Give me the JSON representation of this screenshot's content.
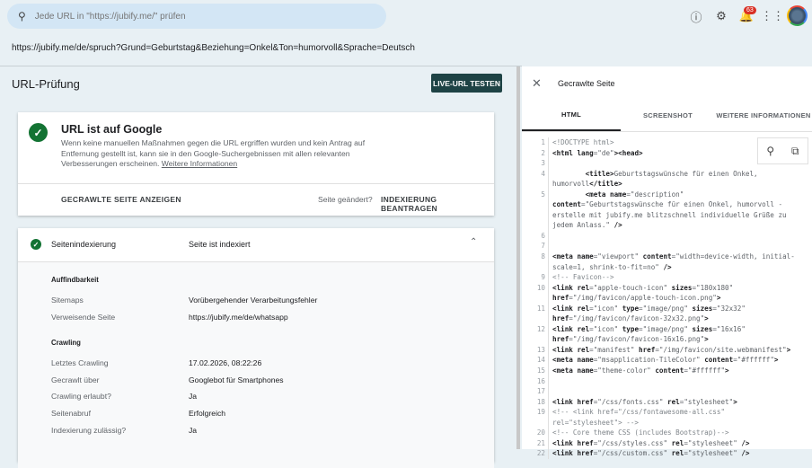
{
  "topbar": {
    "search_placeholder": "Jede URL in \"https://jubify.me/\" prüfen",
    "notification_count": "63"
  },
  "inspected_url": "https://jubify.me/de/spruch?Grund=Geburtstag&Beziehung=Onkel&Ton=humorvoll&Sprache=Deutsch",
  "page_title": "URL-Prüfung",
  "live_test_label": "LIVE-URL TESTEN",
  "status_card": {
    "title": "URL ist auf Google",
    "text": "Wenn keine manuellen Maßnahmen gegen die URL ergriffen wurden und kein Antrag auf Entfernung gestellt ist, kann sie in den Google-Suchergebnissen mit allen relevanten Verbesserungen erscheinen. ",
    "link": "Weitere Informationen",
    "view_crawled": "GECRAWLTE SEITE ANZEIGEN",
    "changed": "Seite geändert?",
    "request_indexing": "INDEXIERUNG BEANTRAGEN"
  },
  "indexing": {
    "label": "Seitenindexierung",
    "value": "Seite ist indexiert",
    "sections": [
      {
        "title": "Auffindbarkeit",
        "rows": [
          {
            "label": "Sitemaps",
            "value": "Vorübergehender Verarbeitungsfehler"
          },
          {
            "label": "Verweisende Seite",
            "value": "https://jubify.me/de/whatsapp"
          }
        ]
      },
      {
        "title": "Crawling",
        "rows": [
          {
            "label": "Letztes Crawling",
            "value": "17.02.2026, 08:22:26"
          },
          {
            "label": "Gecrawlt über",
            "value": "Googlebot für Smartphones"
          },
          {
            "label": "Crawling erlaubt?",
            "value": "Ja"
          },
          {
            "label": "Seitenabruf",
            "value": "Erfolgreich"
          },
          {
            "label": "Indexierung zulässig?",
            "value": "Ja"
          }
        ]
      }
    ]
  },
  "panel": {
    "title": "Gecrawlte Seite",
    "tabs": [
      "HTML",
      "SCREENSHOT",
      "WEITERE INFORMATIONEN"
    ],
    "code": [
      [
        [
          "com",
          "<!DOCTYPE html>"
        ]
      ],
      [
        [
          "tag",
          "<html "
        ],
        [
          "attr",
          "lang"
        ],
        [
          "txt",
          "=\"de\""
        ],
        [
          "tag",
          ">"
        ],
        [
          "tag",
          "<head>"
        ]
      ],
      [],
      [
        [
          "txt",
          "        "
        ],
        [
          "tag",
          "<title>"
        ],
        [
          "txt",
          "Geburtstagswünsche für einen Onkel, humorvoll"
        ],
        [
          "tag",
          "</title>"
        ]
      ],
      [
        [
          "txt",
          "        "
        ],
        [
          "tag",
          "<meta "
        ],
        [
          "attr",
          "name"
        ],
        [
          "txt",
          "=\"description\" "
        ],
        [
          "attr",
          "content"
        ],
        [
          "txt",
          "=\"Geburtstagswünsche für einen Onkel, humorvoll - erstelle mit jubify.me blitzschnell individuelle Grüße zu jedem Anlass.\" "
        ],
        [
          "tag",
          "/>"
        ]
      ],
      [],
      [],
      [
        [
          "tag",
          "<meta "
        ],
        [
          "attr",
          "name"
        ],
        [
          "txt",
          "=\"viewport\" "
        ],
        [
          "attr",
          "content"
        ],
        [
          "txt",
          "=\"width=device-width, initial-scale=1, shrink-to-fit=no\" "
        ],
        [
          "tag",
          "/>"
        ]
      ],
      [
        [
          "com",
          "<!-- Favicon-->"
        ]
      ],
      [
        [
          "tag",
          "<link "
        ],
        [
          "attr",
          "rel"
        ],
        [
          "txt",
          "=\"apple-touch-icon\" "
        ],
        [
          "attr",
          "sizes"
        ],
        [
          "txt",
          "=\"180x180\" "
        ],
        [
          "attr",
          "href"
        ],
        [
          "txt",
          "=\"/img/favicon/apple-touch-icon.png\""
        ],
        [
          "tag",
          ">"
        ]
      ],
      [
        [
          "tag",
          "<link "
        ],
        [
          "attr",
          "rel"
        ],
        [
          "txt",
          "=\"icon\" "
        ],
        [
          "attr",
          "type"
        ],
        [
          "txt",
          "=\"image/png\" "
        ],
        [
          "attr",
          "sizes"
        ],
        [
          "txt",
          "=\"32x32\" "
        ],
        [
          "attr",
          "href"
        ],
        [
          "txt",
          "=\"/img/favicon/favicon-32x32.png\""
        ],
        [
          "tag",
          ">"
        ]
      ],
      [
        [
          "tag",
          "<link "
        ],
        [
          "attr",
          "rel"
        ],
        [
          "txt",
          "=\"icon\" "
        ],
        [
          "attr",
          "type"
        ],
        [
          "txt",
          "=\"image/png\" "
        ],
        [
          "attr",
          "sizes"
        ],
        [
          "txt",
          "=\"16x16\" "
        ],
        [
          "attr",
          "href"
        ],
        [
          "txt",
          "=\"/img/favicon/favicon-16x16.png\""
        ],
        [
          "tag",
          ">"
        ]
      ],
      [
        [
          "tag",
          "<link "
        ],
        [
          "attr",
          "rel"
        ],
        [
          "txt",
          "=\"manifest\" "
        ],
        [
          "attr",
          "href"
        ],
        [
          "txt",
          "=\"/img/favicon/site.webmanifest\""
        ],
        [
          "tag",
          ">"
        ]
      ],
      [
        [
          "tag",
          "<meta "
        ],
        [
          "attr",
          "name"
        ],
        [
          "txt",
          "=\"msapplication-TileColor\" "
        ],
        [
          "attr",
          "content"
        ],
        [
          "txt",
          "=\"#ffffff\""
        ],
        [
          "tag",
          ">"
        ]
      ],
      [
        [
          "tag",
          "<meta "
        ],
        [
          "attr",
          "name"
        ],
        [
          "txt",
          "=\"theme-color\" "
        ],
        [
          "attr",
          "content"
        ],
        [
          "txt",
          "=\"#ffffff\""
        ],
        [
          "tag",
          ">"
        ]
      ],
      [],
      [],
      [
        [
          "tag",
          "<link "
        ],
        [
          "attr",
          "href"
        ],
        [
          "txt",
          "=\"/css/fonts.css\" "
        ],
        [
          "attr",
          "rel"
        ],
        [
          "txt",
          "=\"stylesheet\""
        ],
        [
          "tag",
          ">"
        ]
      ],
      [
        [
          "com",
          "<!-- <link href=\"/css/fontawesome-all.css\" rel=\"stylesheet\"> -->"
        ]
      ],
      [
        [
          "com",
          "<!-- Core theme CSS (includes Bootstrap)-->"
        ]
      ],
      [
        [
          "tag",
          "<link "
        ],
        [
          "attr",
          "href"
        ],
        [
          "txt",
          "=\"/css/styles.css\" "
        ],
        [
          "attr",
          "rel"
        ],
        [
          "txt",
          "=\"stylesheet\" "
        ],
        [
          "tag",
          "/>"
        ]
      ],
      [
        [
          "tag",
          "<link "
        ],
        [
          "attr",
          "href"
        ],
        [
          "txt",
          "=\"/css/custom.css\" "
        ],
        [
          "attr",
          "rel"
        ],
        [
          "txt",
          "=\"stylesheet\" "
        ],
        [
          "tag",
          "/>"
        ]
      ]
    ]
  }
}
